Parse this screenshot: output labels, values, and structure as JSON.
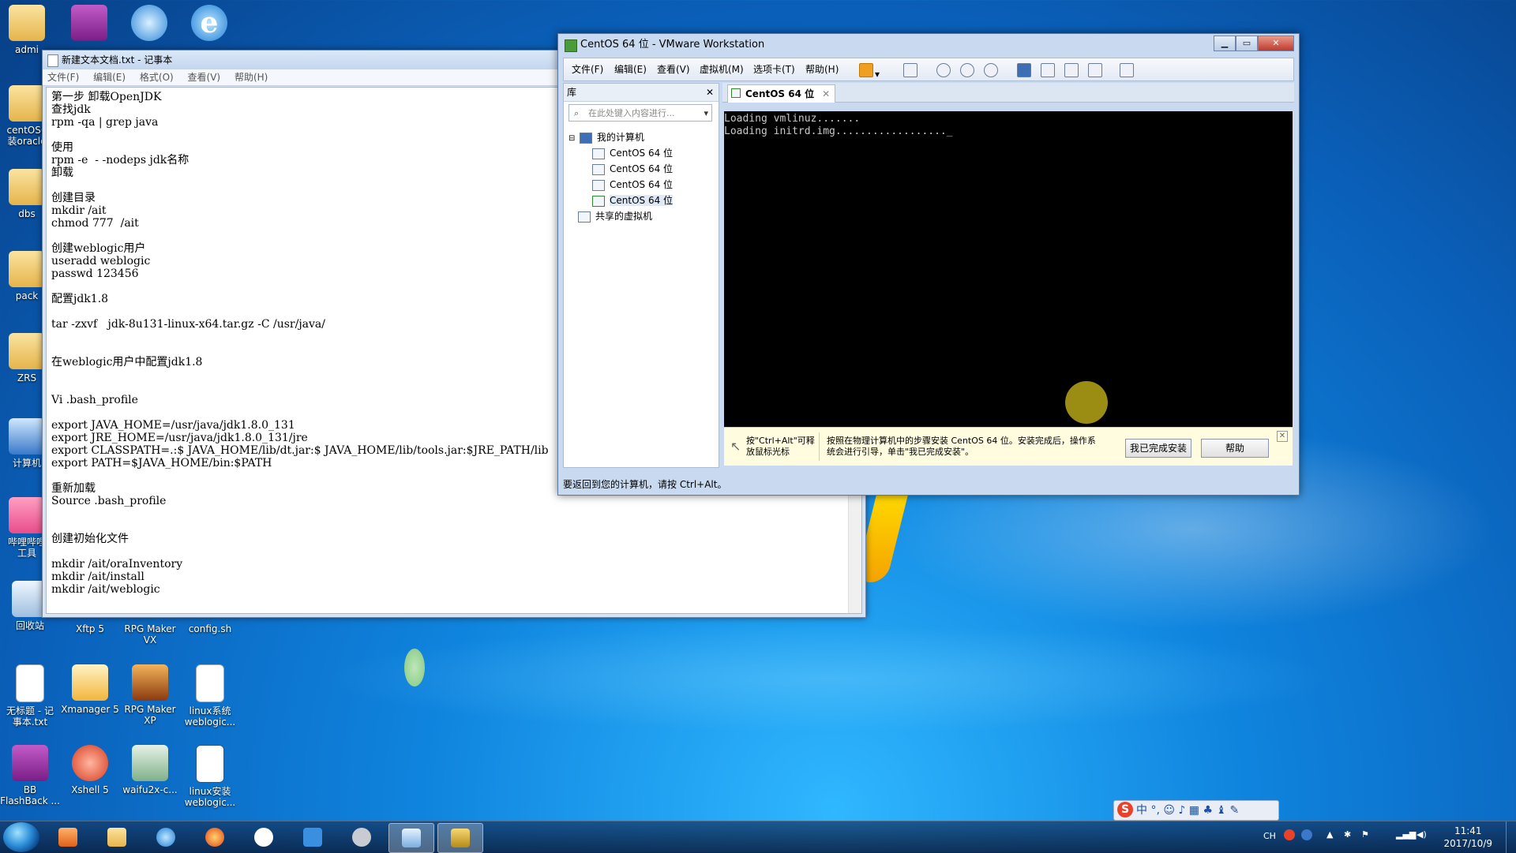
{
  "desktop": {
    "icons_left": [
      {
        "label": "admi"
      },
      {
        "label": "centOS6\n装oracle"
      },
      {
        "label": "dbs"
      },
      {
        "label": "pack"
      },
      {
        "label": "ZRS"
      },
      {
        "label": "计算机"
      },
      {
        "label": "哔哩哔哩\n工具"
      },
      {
        "label": "回收站"
      }
    ],
    "icons_grid": [
      {
        "label": "Xftp 5"
      },
      {
        "label": "RPG Maker\nVX"
      },
      {
        "label": "config.sh"
      },
      {
        "label": "无标题 - 记\n事本.txt"
      },
      {
        "label": "Xmanager 5"
      },
      {
        "label": "RPG Maker\nXP"
      },
      {
        "label": "linux系统\nweblogic..."
      },
      {
        "label": "BB\nFlashBack ..."
      },
      {
        "label": "Xshell 5"
      },
      {
        "label": "waifu2x-c..."
      },
      {
        "label": "linux安装\nweblogic..."
      }
    ]
  },
  "notepad": {
    "title": "新建文本文档.txt - 记事本",
    "menu": [
      "文件(F)",
      "编辑(E)",
      "格式(O)",
      "查看(V)",
      "帮助(H)"
    ],
    "content": "第一步 卸载OpenJDK\n查找jdk\nrpm -qa | grep java\n\n使用\nrpm -e  - -nodeps jdk名称\n卸载\n\n创建目录\nmkdir /ait\nchmod 777  /ait\n\n创建weblogic用户\nuseradd weblogic\npasswd 123456\n\n配置jdk1.8\n\ntar -zxvf   jdk-8u131-linux-x64.tar.gz -C /usr/java/\n\n\n在weblogic用户中配置jdk1.8\n\n\nVi .bash_profile\n\nexport JAVA_HOME=/usr/java/jdk1.8.0_131\nexport JRE_HOME=/usr/java/jdk1.8.0_131/jre\nexport CLASSPATH=.:$ JAVA_HOME/lib/dt.jar:$ JAVA_HOME/lib/tools.jar:$JRE_PATH/lib\nexport PATH=$JAVA_HOME/bin:$PATH\n\n重新加载\nSource .bash_profile\n\n\n创建初始化文件\n\nmkdir /ait/oraInventory\nmkdir /ait/install\nmkdir /ait/weblogic"
  },
  "vmware": {
    "title": "CentOS 64 位 - VMware Workstation",
    "menu": [
      "文件(F)",
      "编辑(E)",
      "查看(V)",
      "虚拟机(M)",
      "选项卡(T)",
      "帮助(H)"
    ],
    "library": {
      "header": "库",
      "search_placeholder": "在此处键入内容进行...",
      "root": "我的计算机",
      "vms": [
        "CentOS 64 位",
        "CentOS 64 位",
        "CentOS 64 位",
        "CentOS 64 位"
      ],
      "shared": "共享的虚拟机"
    },
    "tab": "CentOS 64 位",
    "console": "Loading vmlinuz.......\nLoading initrd.img.................._",
    "hint": {
      "left": "按\"Ctrl+Alt\"可释\n放鼠标光标",
      "main": "按照在物理计算机中的步骤安装 CentOS 64 位。安装完成后，操作系\n统会进行引导，单击\"我已完成安装\"。",
      "done_button": "我已完成安装",
      "help_button": "帮助"
    },
    "status": "要返回到您的计算机，请按 Ctrl+Alt。"
  },
  "ime": {
    "text": "中 °, ☺ ♪ ▦ ♣ ♝ ✎"
  },
  "taskbar": {
    "clock_time": "11:41",
    "clock_date": "2017/10/9",
    "tray_lang": "CH"
  }
}
